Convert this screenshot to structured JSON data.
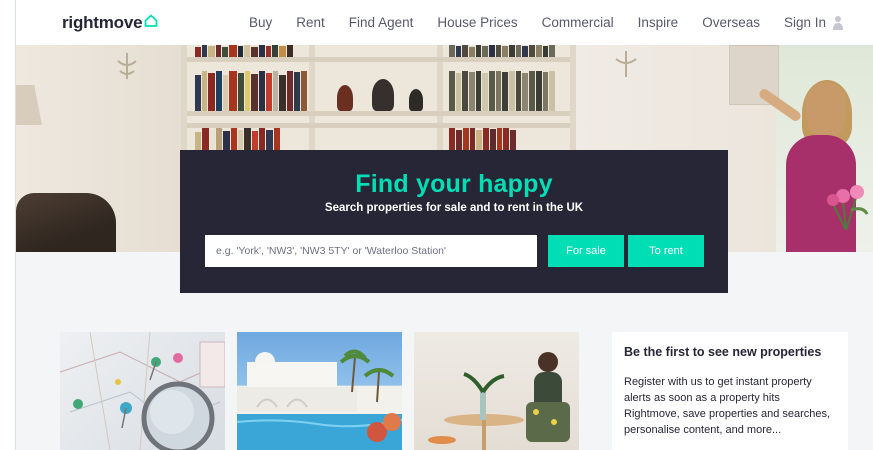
{
  "header": {
    "logo_text": "rightmove",
    "nav": [
      "Buy",
      "Rent",
      "Find Agent",
      "House Prices",
      "Commercial",
      "Inspire",
      "Overseas"
    ],
    "sign_in": "Sign In"
  },
  "hero": {
    "headline": "Find your happy",
    "subline": "Search properties for sale and to rent in the UK",
    "search_placeholder": "e.g. 'York', 'NW3', 'NW3 5TY' or 'Waterloo Station'",
    "for_sale_label": "For sale",
    "to_rent_label": "To rent"
  },
  "promo": {
    "title": "Be the first to see new properties",
    "body": "Register with us to get instant property alerts as soon as a property hits Rightmove, save properties and searches, personalise content, and more..."
  },
  "colors": {
    "brand_dark": "#262637",
    "accent": "#00deb6",
    "page_bg": "#f4f5f7"
  },
  "icons": [
    "house-logo-icon",
    "user-icon"
  ]
}
